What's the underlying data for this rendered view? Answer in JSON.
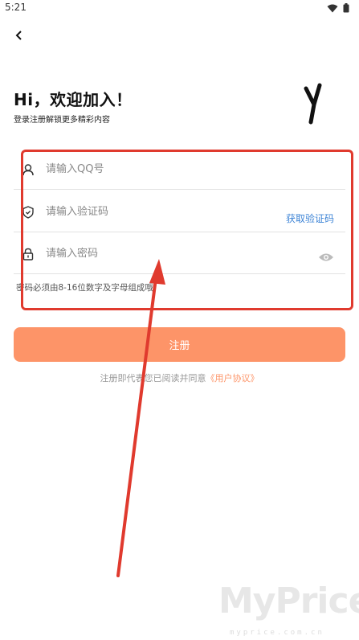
{
  "status_bar": {
    "time": "5:21",
    "icons": [
      "wifi-icon",
      "battery-icon"
    ]
  },
  "nav": {
    "back_icon": "chevron-left-icon"
  },
  "header": {
    "greeting": "Hi，欢迎加入！",
    "subtitle": "登录注册解锁更多精彩内容",
    "logo_text": "y"
  },
  "form": {
    "qq": {
      "placeholder": "请输入QQ号",
      "value": "",
      "icon": "user-icon"
    },
    "code": {
      "placeholder": "请输入验证码",
      "value": "",
      "icon": "shield-icon",
      "action_label": "获取验证码"
    },
    "password": {
      "placeholder": "请输入密码",
      "value": "",
      "icon": "lock-icon",
      "toggle_icon": "eye-icon"
    },
    "hint": "密码必须由8-16位数字及字母组成哦"
  },
  "actions": {
    "register_label": "注册"
  },
  "agreement": {
    "prefix": "注册即代表您已阅读并同意",
    "link": "《用户协议》"
  },
  "watermark": {
    "big": "MyPrice",
    "small": "myprice.com.cn"
  },
  "colors": {
    "accent": "#fd9468",
    "link": "#3d84d6",
    "annotation": "#e03a2e"
  }
}
